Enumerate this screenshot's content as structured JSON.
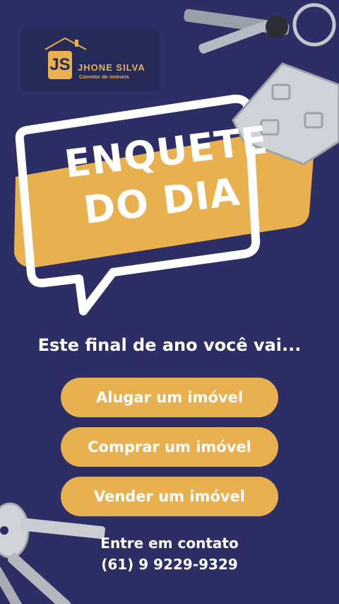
{
  "brand": {
    "monogram": "JS",
    "name": "JHONE SILVA",
    "subtitle": "Corretor de imóveis"
  },
  "headline": {
    "line1": "ENQUETE",
    "line2": "DO DIA"
  },
  "question": "Este final de ano você vai...",
  "options": [
    {
      "label": "Alugar um imóvel"
    },
    {
      "label": "Comprar um imóvel"
    },
    {
      "label": "Vender um imóvel"
    }
  ],
  "contact": {
    "label": "Entre em contato",
    "phone": "(61) 9 9229-9329"
  },
  "colors": {
    "background": "#2e2e66",
    "accent": "#e8b04f",
    "text": "#ffffff"
  },
  "icons": [
    "house-roof-icon",
    "keys-icon",
    "house-keychain-icon",
    "speech-bubble-icon"
  ]
}
